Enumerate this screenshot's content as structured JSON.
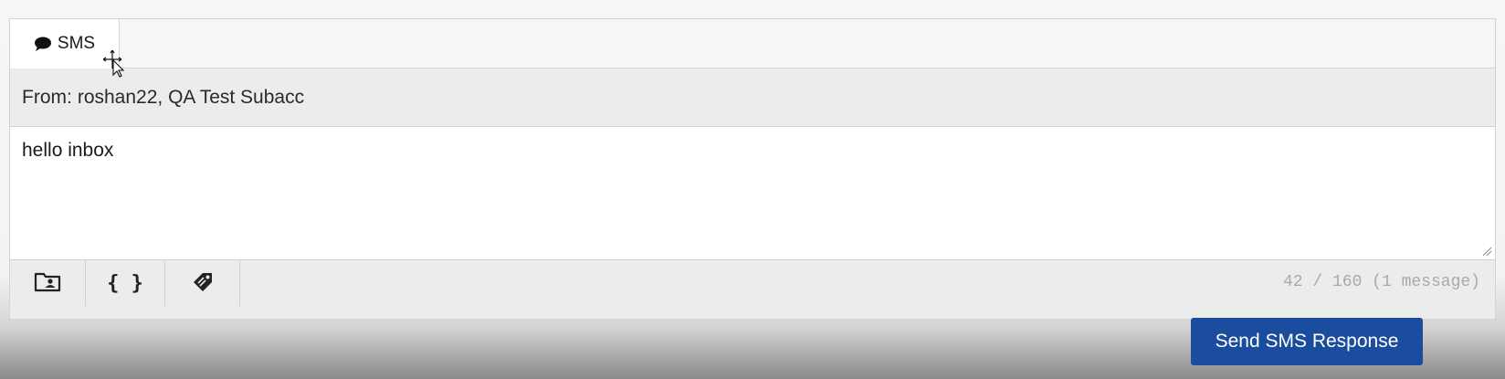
{
  "tabs": [
    {
      "label": "SMS",
      "icon": "speech-bubble-icon",
      "active": true
    }
  ],
  "from": {
    "label": "From:",
    "value": "roshan22, QA Test Subacc"
  },
  "message": {
    "value": "hello inbox"
  },
  "toolbar": {
    "buttons": [
      {
        "icon": "contact-folder-icon"
      },
      {
        "icon": "braces-icon",
        "glyph": "{ }"
      },
      {
        "icon": "tag-icon"
      }
    ],
    "counter": "42 / 160  (1 message)"
  },
  "send_button": {
    "label": "Send SMS Response"
  },
  "colors": {
    "primary": "#1b4d9e",
    "counter_text": "#a9a9a9"
  }
}
